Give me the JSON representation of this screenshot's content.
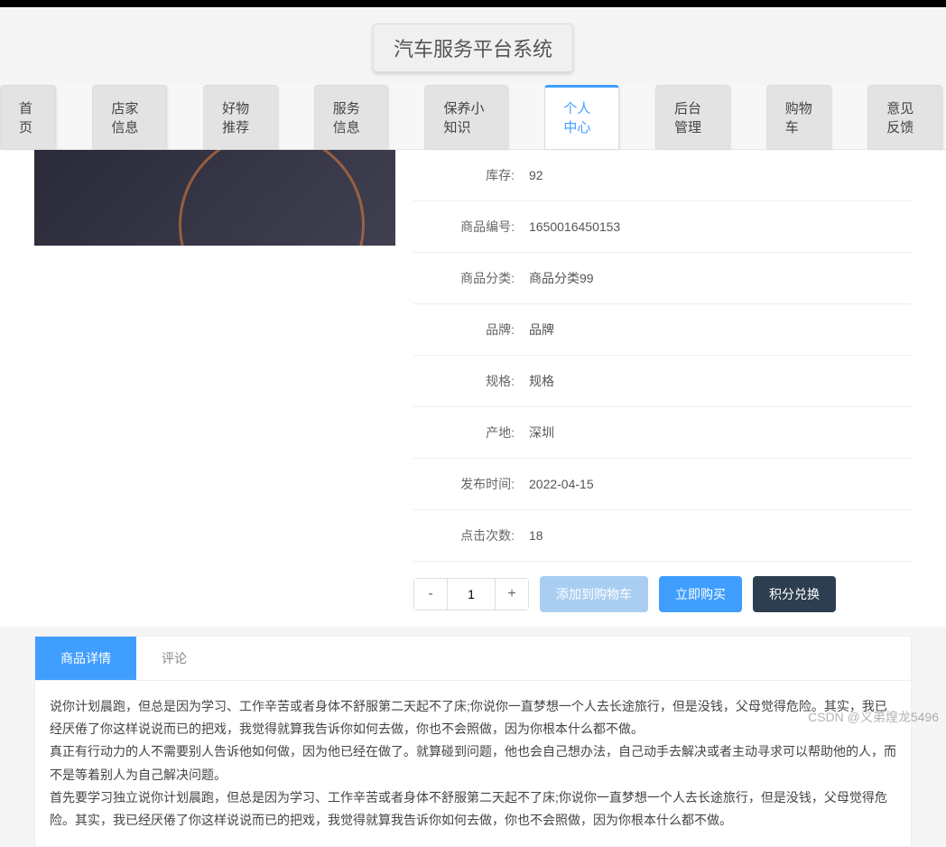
{
  "header": {
    "title": "汽车服务平台系统"
  },
  "nav": {
    "items": [
      {
        "label": "首页"
      },
      {
        "label": "店家信息"
      },
      {
        "label": "好物推荐"
      },
      {
        "label": "服务信息"
      },
      {
        "label": "保养小知识"
      },
      {
        "label": "个人中心",
        "active": true
      },
      {
        "label": "后台管理"
      },
      {
        "label": "购物车"
      },
      {
        "label": "意见反馈"
      }
    ]
  },
  "detail": {
    "rows": [
      {
        "label": "库存:",
        "value": "92"
      },
      {
        "label": "商品编号:",
        "value": "1650016450153"
      },
      {
        "label": "商品分类:",
        "value": "商品分类99"
      },
      {
        "label": "品牌:",
        "value": "品牌"
      },
      {
        "label": "规格:",
        "value": "规格"
      },
      {
        "label": "产地:",
        "value": "深圳"
      },
      {
        "label": "发布时间:",
        "value": "2022-04-15"
      },
      {
        "label": "点击次数:",
        "value": "18"
      }
    ]
  },
  "actions": {
    "qty_minus": "-",
    "qty_value": "1",
    "qty_plus": "+",
    "add_cart": "添加到购物车",
    "buy_now": "立即购买",
    "points": "积分兑换"
  },
  "tabs": {
    "items": [
      {
        "label": "商品详情",
        "active": true
      },
      {
        "label": "评论"
      }
    ],
    "content_p1": "说你计划晨跑，但总是因为学习、工作辛苦或者身体不舒服第二天起不了床;你说你一直梦想一个人去长途旅行，但是没钱，父母觉得危险。其实，我已经厌倦了你这样说说而已的把戏，​我觉得就算我告诉你如何去做，你也不会照做，因为你根本什么都不做。",
    "content_p2": "真正有行动力的人不需要别人告诉他如何做，因为他已经在做了。就算碰到问题，他也会自己想办法，自己动手去解决或者主动寻求可以帮助他的人，而不是等着别人为自己解决问题。",
    "content_p3": "首先要学习独立说你计划晨跑，但总是因为学习、工作辛苦或者身体不舒服第二天起不了床;你说你一直梦想一个人去长途旅行，但是没钱，父母觉得危险。其实，我已经厌倦了你这样说说而已的把戏，​我觉得就算我告诉你如何去做，你也不会照做，因为你根本什么都不做。"
  },
  "watermark": "CSDN @义弟煌龙5496"
}
